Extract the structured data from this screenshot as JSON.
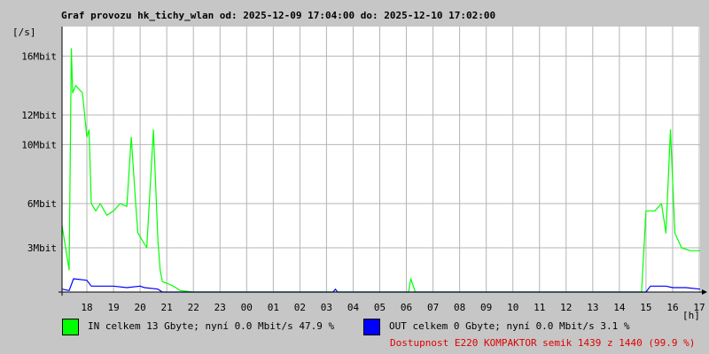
{
  "title": "Graf provozu hk_tichy_wlan od: 2025-12-09 17:04:00 do: 2025-12-10 17:02:00",
  "y_unit": "[/s]",
  "x_unit": "[h]",
  "legend": {
    "in": {
      "text": "IN celkem 13 Gbyte; nyní   0.0 Mbit/s 47.9 %",
      "color": "#00ff00"
    },
    "out": {
      "text": "OUT celkem 0 Gbyte; nyní   0.0 Mbit/s 3.1 %",
      "color": "#0000ff"
    }
  },
  "availability": "Dostupnost E220 KOMPAKTOR semik 1439 z 1440 (99.9 %)",
  "chart_data": {
    "type": "area",
    "title": "Graf provozu hk_tichy_wlan od: 2025-12-09 17:04:00 do: 2025-12-10 17:02:00",
    "xlabel": "[h]",
    "ylabel": "[/s]",
    "x_ticks": [
      "18",
      "19",
      "20",
      "21",
      "22",
      "23",
      "00",
      "01",
      "02",
      "03",
      "04",
      "05",
      "06",
      "07",
      "08",
      "09",
      "10",
      "11",
      "12",
      "13",
      "14",
      "15",
      "16",
      "17"
    ],
    "y_ticks": [
      {
        "value": 3,
        "label": "3Mbit"
      },
      {
        "value": 6,
        "label": "6Mbit"
      },
      {
        "value": 10,
        "label": "10Mbit"
      },
      {
        "value": 12,
        "label": "12Mbit"
      },
      {
        "value": 16,
        "label": "16Mbit"
      }
    ],
    "ylim": [
      0,
      18
    ],
    "xlim": [
      "2025-12-09 17:04",
      "2025-12-10 17:02"
    ],
    "grid": true,
    "colors": {
      "background": "#ffffff",
      "grid": "#b4b4b4",
      "in": "#00ff00",
      "out": "#0000ff"
    },
    "series": [
      {
        "name": "IN",
        "color": "#00ff00",
        "x": [
          "2025-12-09 17:04",
          "2025-12-09 17:20",
          "2025-12-09 17:25",
          "2025-12-09 17:28",
          "2025-12-09 17:35",
          "2025-12-09 17:50",
          "2025-12-09 18:00",
          "2025-12-09 18:05",
          "2025-12-09 18:10",
          "2025-12-09 18:20",
          "2025-12-09 18:30",
          "2025-12-09 18:45",
          "2025-12-09 19:00",
          "2025-12-09 19:15",
          "2025-12-09 19:30",
          "2025-12-09 19:40",
          "2025-12-09 19:50",
          "2025-12-09 19:55",
          "2025-12-09 20:05",
          "2025-12-09 20:15",
          "2025-12-09 20:30",
          "2025-12-09 20:40",
          "2025-12-09 20:45",
          "2025-12-09 20:50",
          "2025-12-09 21:00",
          "2025-12-09 21:15",
          "2025-12-09 21:30",
          "2025-12-09 22:00",
          "2025-12-10 06:05",
          "2025-12-10 06:10",
          "2025-12-10 06:20",
          "2025-12-10 14:50",
          "2025-12-10 15:00",
          "2025-12-10 15:20",
          "2025-12-10 15:35",
          "2025-12-10 15:45",
          "2025-12-10 15:55",
          "2025-12-10 16:05",
          "2025-12-10 16:20",
          "2025-12-10 16:40",
          "2025-12-10 17:02"
        ],
        "values": [
          4.5,
          1.5,
          16.5,
          13.5,
          14,
          13.5,
          10.5,
          11,
          6,
          5.5,
          6,
          5.2,
          5.5,
          6,
          5.8,
          10.5,
          6,
          4,
          3.5,
          3,
          11,
          3.5,
          1.5,
          0.7,
          0.6,
          0.4,
          0.1,
          0,
          0,
          0.9,
          0,
          0,
          5.5,
          5.5,
          6,
          4,
          11,
          4,
          3,
          2.8,
          2.8
        ]
      },
      {
        "name": "OUT",
        "color": "#0000ff",
        "x": [
          "2025-12-09 17:04",
          "2025-12-09 17:20",
          "2025-12-09 17:30",
          "2025-12-09 18:00",
          "2025-12-09 18:10",
          "2025-12-09 19:00",
          "2025-12-09 19:30",
          "2025-12-09 20:00",
          "2025-12-09 20:10",
          "2025-12-09 20:40",
          "2025-12-09 20:50",
          "2025-12-10 03:15",
          "2025-12-10 03:20",
          "2025-12-10 03:25",
          "2025-12-10 15:00",
          "2025-12-10 15:10",
          "2025-12-10 15:45",
          "2025-12-10 16:00",
          "2025-12-10 16:30",
          "2025-12-10 17:02"
        ],
        "values": [
          0.2,
          0.1,
          0.9,
          0.8,
          0.4,
          0.4,
          0.3,
          0.4,
          0.3,
          0.2,
          0,
          0,
          0.2,
          0,
          0,
          0.4,
          0.4,
          0.3,
          0.3,
          0.2
        ]
      }
    ]
  }
}
